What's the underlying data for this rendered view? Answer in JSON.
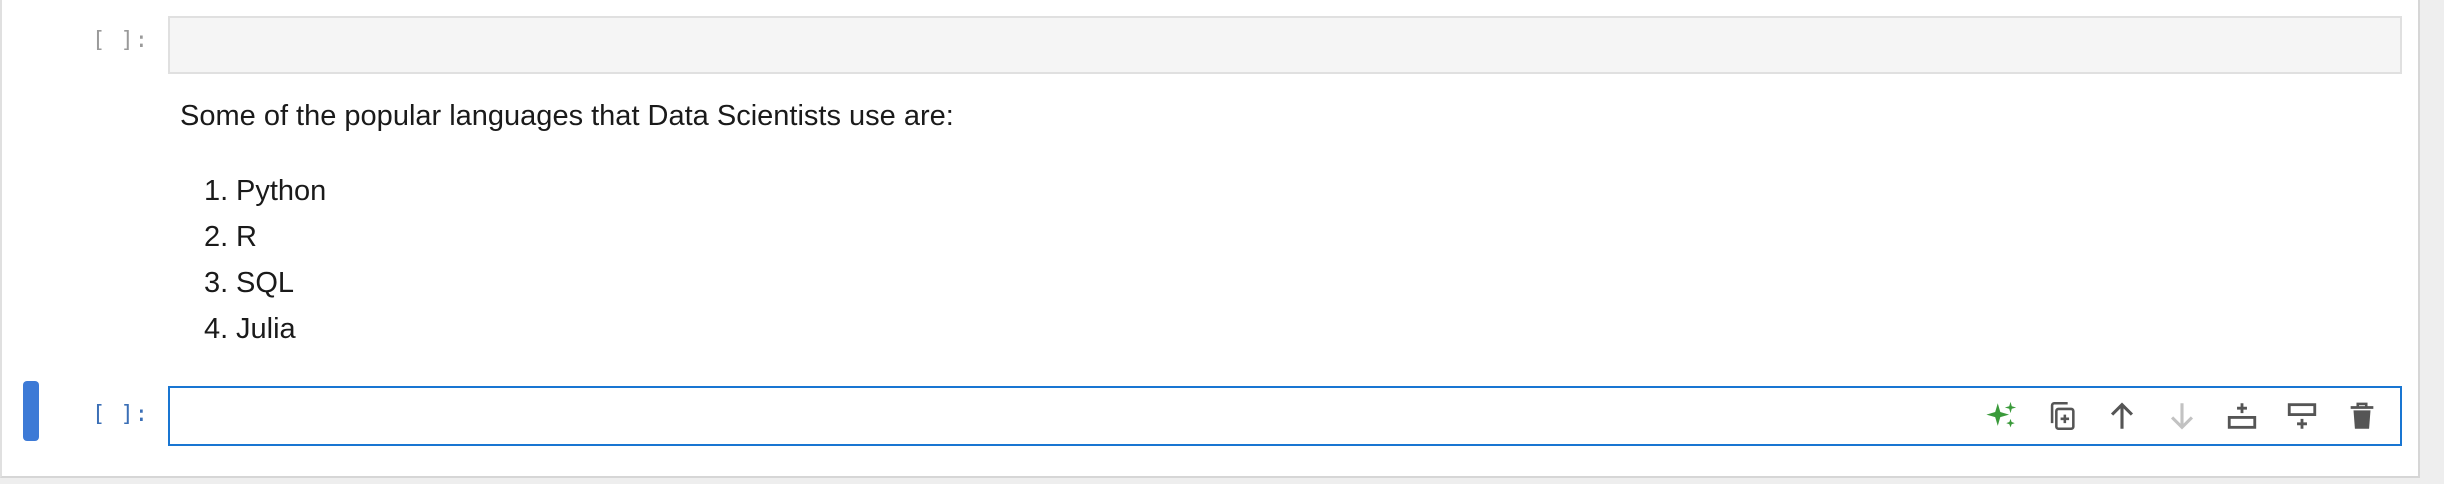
{
  "cells": {
    "code_cell_1": {
      "prompt": "[ ]:"
    },
    "markdown_cell": {
      "intro": "Some of the popular languages that Data Scientists use are:",
      "items": [
        {
          "num": "1.",
          "text": "Python"
        },
        {
          "num": "2.",
          "text": "R"
        },
        {
          "num": "3.",
          "text": "SQL"
        },
        {
          "num": "4.",
          "text": "Julia"
        }
      ]
    },
    "code_cell_2": {
      "prompt": "[ ]:"
    }
  },
  "cell_toolbar": {
    "icons": [
      "sparkle-ai-icon",
      "duplicate-cell-icon",
      "move-up-icon",
      "move-down-icon",
      "insert-cell-above-icon",
      "insert-cell-below-icon",
      "delete-cell-icon"
    ]
  },
  "colors": {
    "active_border": "#1976d2",
    "collapser": "#3d7ad6",
    "prompt_inactive": "#9a9a9a",
    "prompt_active": "#3b6fb6",
    "ai_icon": "#3a9a3a",
    "toolbar_icon": "#555555",
    "toolbar_icon_disabled": "#c2c2c2"
  }
}
